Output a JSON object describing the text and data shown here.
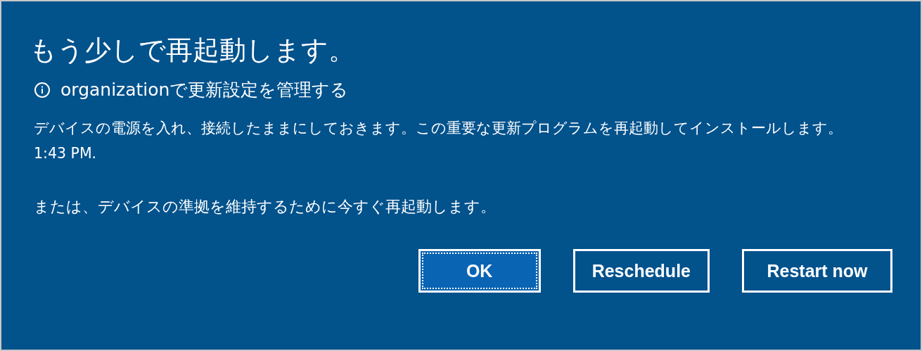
{
  "dialog": {
    "title": "もう少しで再起動します。",
    "info": "organizationで更新設定を管理する",
    "message": "デバイスの電源を入れ、接続したままにしておきます。この重要な更新プログラムを再起動してインストールします。",
    "time": "1:43 PM.",
    "note": "または、デバイスの準拠を維持するために今すぐ再起動します。",
    "buttons": [
      {
        "label": "OK",
        "selected": true
      },
      {
        "label": "Reschedule",
        "selected": false
      },
      {
        "label": "Restart now",
        "selected": false
      }
    ]
  }
}
